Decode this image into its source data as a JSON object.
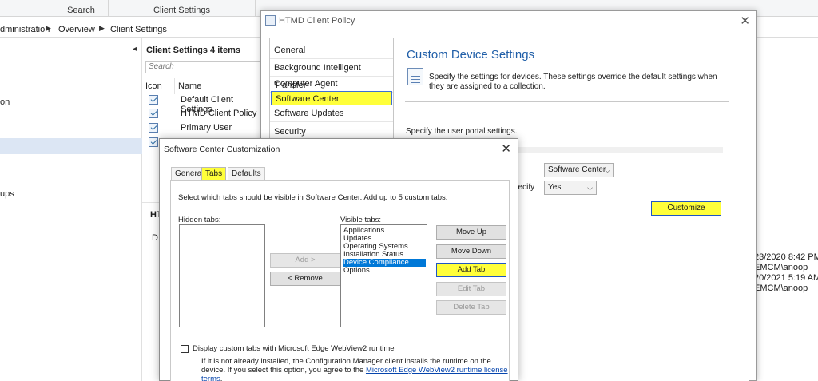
{
  "ribbon": {
    "groups": [
      {
        "label": "Search"
      },
      {
        "label": "Client Settings"
      },
      {
        "label": ""
      }
    ]
  },
  "breadcrumb": {
    "items": [
      "dministration",
      "Overview",
      "Client Settings"
    ]
  },
  "left_nav": {
    "items": [
      "on",
      "ups"
    ]
  },
  "list": {
    "title": "Client Settings 4 items",
    "search_placeholder": "Search",
    "columns": {
      "icon": "Icon",
      "name": "Name"
    },
    "rows": [
      {
        "name": "Default Client Settings"
      },
      {
        "name": "HTMD Client Policy"
      },
      {
        "name": "Primary User"
      }
    ]
  },
  "details": {
    "title": "HT",
    "line": "D"
  },
  "right_info": {
    "lines": [
      "23/2020 8:42 PM",
      "EMCM\\anoop",
      "20/2021 5:19 AM",
      "EMCM\\anoop"
    ]
  },
  "policy_dialog": {
    "title": "HTMD Client Policy",
    "nav": [
      "General",
      "Background Intelligent Transfer",
      "Computer Agent",
      "Software Center",
      "Software Updates",
      "Security"
    ],
    "selected_nav": "Software Center",
    "heading": "Custom Device Settings",
    "description": "Specify the settings for devices. These settings override the default settings when they are assigned to a collection.",
    "portal_text": "Specify the user portal settings.",
    "select_portal": "Software Center",
    "select_yes": "Yes",
    "cut_label": "pecify",
    "customize_button": "Customize",
    "highlight_color": "#ffff3a"
  },
  "customization_dialog": {
    "title": "Software Center Customization",
    "tabs": [
      "General",
      "Tabs",
      "Defaults"
    ],
    "active_tab": "Tabs",
    "instruction": "Select which tabs should be visible in Software Center. Add up to 5 custom tabs.",
    "hidden_label": "Hidden tabs:",
    "visible_label": "Visible tabs:",
    "visible_tabs": [
      "Applications",
      "Updates",
      "Operating Systems",
      "Installation Status",
      "Device Compliance",
      "Options"
    ],
    "selected_visible": "Device Compliance",
    "buttons": {
      "add": "Add >",
      "remove": "< Remove",
      "move_up": "Move Up",
      "move_down": "Move Down",
      "add_tab": "Add Tab",
      "edit_tab": "Edit Tab",
      "delete_tab": "Delete Tab"
    },
    "checkbox_label": "Display custom tabs with Microsoft Edge WebView2 runtime",
    "note_text": "If it is not already installed, the Configuration Manager client installs the runtime on the device. If you select this option, you agree to the",
    "note_link": "Microsoft Edge WebView2 runtime license terms",
    "note_end": "."
  }
}
